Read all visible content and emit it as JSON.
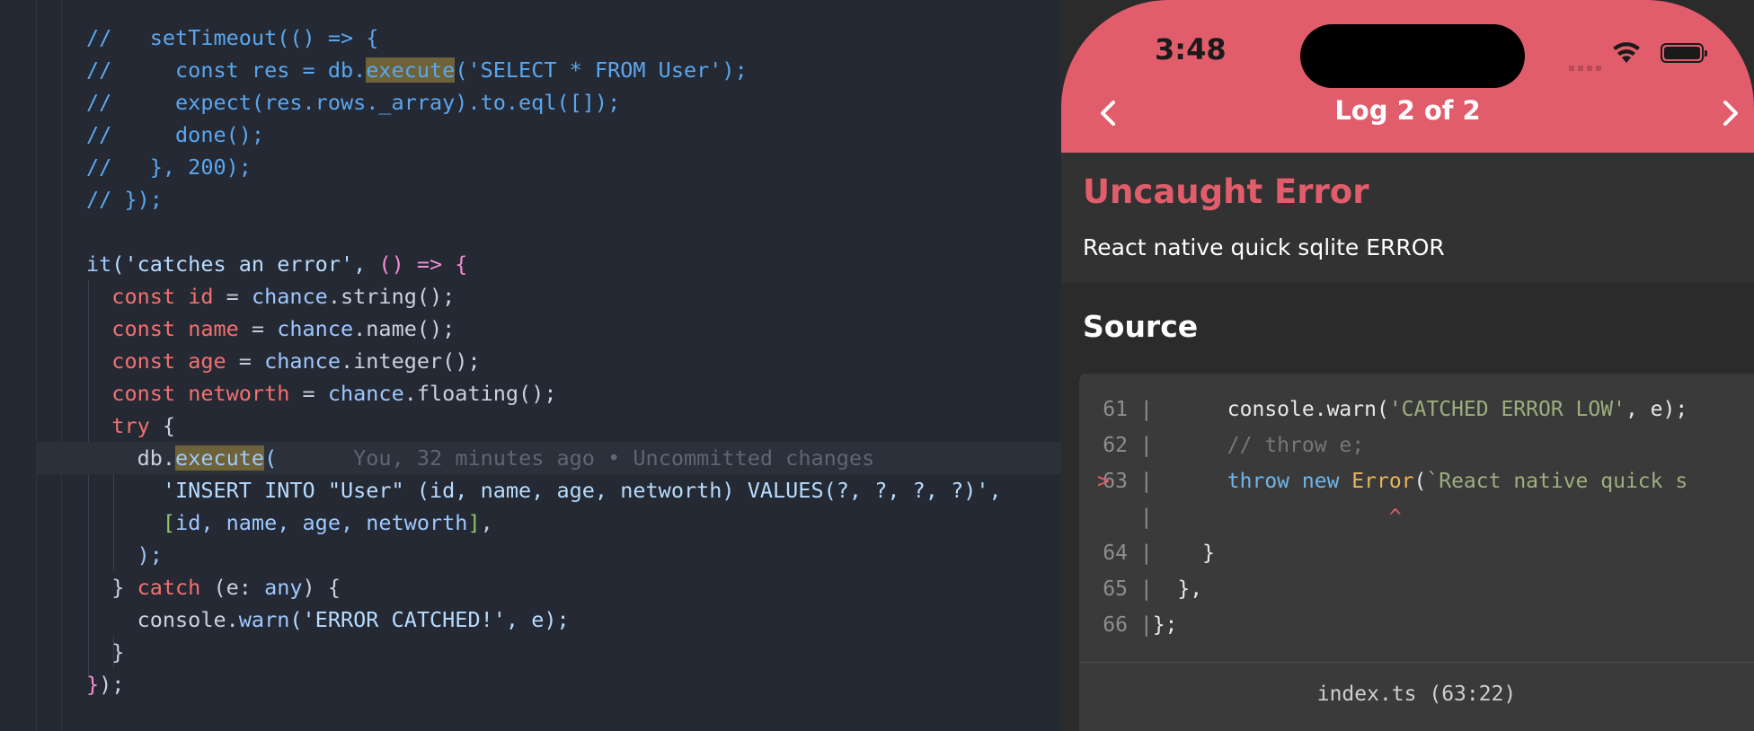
{
  "editor": {
    "lines": [
      {
        "segments": [
          {
            "t": "//   setTimeout(() => {",
            "c": "tok-comment"
          }
        ]
      },
      {
        "segments": [
          {
            "t": "//     const res = db.",
            "c": "tok-comment"
          },
          {
            "t": "execute",
            "c": "tok-comment hl"
          },
          {
            "t": "('SELECT * FROM User');",
            "c": "tok-comment"
          }
        ]
      },
      {
        "segments": [
          {
            "t": "//     expect(res.rows._array).to.eql([]);",
            "c": "tok-comment"
          }
        ]
      },
      {
        "segments": [
          {
            "t": "//     done();",
            "c": "tok-comment"
          }
        ]
      },
      {
        "segments": [
          {
            "t": "//   }, 200);",
            "c": "tok-comment"
          }
        ]
      },
      {
        "segments": [
          {
            "t": "// });",
            "c": "tok-comment"
          }
        ]
      },
      {
        "segments": []
      },
      {
        "segments": [
          {
            "t": "it",
            "c": "tok-fn"
          },
          {
            "t": "('catches an error', ",
            "c": "tok-str"
          },
          {
            "t": "() => {",
            "c": "tok-brk1"
          }
        ]
      },
      {
        "segments": [
          {
            "t": "  const ",
            "c": "tok-kw"
          },
          {
            "t": "id",
            "c": "tok-kw"
          },
          {
            "t": " = ",
            "c": "tok-punc"
          },
          {
            "t": "chance",
            "c": "tok-fn"
          },
          {
            "t": ".string();",
            "c": "tok-var"
          }
        ]
      },
      {
        "segments": [
          {
            "t": "  const ",
            "c": "tok-kw"
          },
          {
            "t": "name",
            "c": "tok-kw"
          },
          {
            "t": " = ",
            "c": "tok-punc"
          },
          {
            "t": "chance",
            "c": "tok-fn"
          },
          {
            "t": ".name();",
            "c": "tok-var"
          }
        ]
      },
      {
        "segments": [
          {
            "t": "  const ",
            "c": "tok-kw"
          },
          {
            "t": "age",
            "c": "tok-kw"
          },
          {
            "t": " = ",
            "c": "tok-punc"
          },
          {
            "t": "chance",
            "c": "tok-fn"
          },
          {
            "t": ".integer();",
            "c": "tok-var"
          }
        ]
      },
      {
        "segments": [
          {
            "t": "  const ",
            "c": "tok-kw"
          },
          {
            "t": "networth",
            "c": "tok-kw"
          },
          {
            "t": " = ",
            "c": "tok-punc"
          },
          {
            "t": "chance",
            "c": "tok-fn"
          },
          {
            "t": ".floating();",
            "c": "tok-var"
          }
        ]
      },
      {
        "segments": [
          {
            "t": "  try ",
            "c": "tok-kw"
          },
          {
            "t": "{",
            "c": "tok-var"
          }
        ]
      },
      {
        "segments": [
          {
            "t": "    db.",
            "c": "tok-var"
          },
          {
            "t": "execute",
            "c": "tok-fn hl"
          },
          {
            "t": "(",
            "c": "tok-fn"
          },
          {
            "t": "      You, 32 minutes ago • Uncommitted changes",
            "c": "blame"
          }
        ]
      },
      {
        "segments": [
          {
            "t": "      'INSERT INTO \"User\" (id, name, age, networth) VALUES(?, ?, ?, ?)',",
            "c": "tok-str"
          }
        ]
      },
      {
        "segments": [
          {
            "t": "      ",
            "c": "tok-var"
          },
          {
            "t": "[",
            "c": "tok-brk2"
          },
          {
            "t": "id, name, age, networth",
            "c": "tok-fn"
          },
          {
            "t": "]",
            "c": "tok-brk2"
          },
          {
            "t": ",",
            "c": "tok-var"
          }
        ]
      },
      {
        "segments": [
          {
            "t": "    );",
            "c": "tok-fn"
          }
        ]
      },
      {
        "segments": [
          {
            "t": "  } ",
            "c": "tok-var"
          },
          {
            "t": "catch ",
            "c": "tok-kw"
          },
          {
            "t": "(e: ",
            "c": "tok-var"
          },
          {
            "t": "any",
            "c": "tok-fn"
          },
          {
            "t": ") {",
            "c": "tok-var"
          }
        ]
      },
      {
        "segments": [
          {
            "t": "    console.",
            "c": "tok-var"
          },
          {
            "t": "warn",
            "c": "tok-fn"
          },
          {
            "t": "('ERROR CATCHED!', e);",
            "c": "tok-str"
          }
        ]
      },
      {
        "segments": [
          {
            "t": "  }",
            "c": "tok-var"
          }
        ]
      },
      {
        "segments": [
          {
            "t": "}",
            "c": "tok-brk1"
          },
          {
            "t": ");",
            "c": "tok-var"
          }
        ]
      }
    ]
  },
  "phone": {
    "status_time": "3:48",
    "nav_title": "Log 2 of 2",
    "error_title": "Uncaught Error",
    "error_message": "React native quick sqlite ERROR",
    "source_heading": "Source",
    "source_lines": [
      {
        "marker": "",
        "num": "61",
        "segments": [
          {
            "t": "      console.",
            "c": ""
          },
          {
            "t": "warn",
            "c": ""
          },
          {
            "t": "(",
            "c": ""
          },
          {
            "t": "'CATCHED ERROR LOW'",
            "c": "frame-str"
          },
          {
            "t": ", e);",
            "c": ""
          }
        ]
      },
      {
        "marker": "",
        "num": "62",
        "segments": [
          {
            "t": "      // throw e;",
            "c": "frame-comment"
          }
        ]
      },
      {
        "marker": ">",
        "num": "63",
        "segments": [
          {
            "t": "      ",
            "c": ""
          },
          {
            "t": "throw new ",
            "c": "frame-kw"
          },
          {
            "t": "Error",
            "c": "frame-err"
          },
          {
            "t": "(",
            "c": ""
          },
          {
            "t": "`React native quick s",
            "c": "frame-str"
          }
        ]
      },
      {
        "marker": "",
        "num": "",
        "segments": [
          {
            "t": "                   ",
            "c": ""
          },
          {
            "t": "^",
            "c": "frame-caret"
          }
        ]
      },
      {
        "marker": "",
        "num": "64",
        "segments": [
          {
            "t": "    }",
            "c": ""
          }
        ]
      },
      {
        "marker": "",
        "num": "65",
        "segments": [
          {
            "t": "  },",
            "c": ""
          }
        ]
      },
      {
        "marker": "",
        "num": "66",
        "segments": [
          {
            "t": "};",
            "c": ""
          }
        ]
      }
    ],
    "source_file": "index.ts (63:22)"
  },
  "colors": {
    "accent": "#e25d6c",
    "editor_bg": "#242933",
    "phone_bg": "#2b2b2b"
  }
}
